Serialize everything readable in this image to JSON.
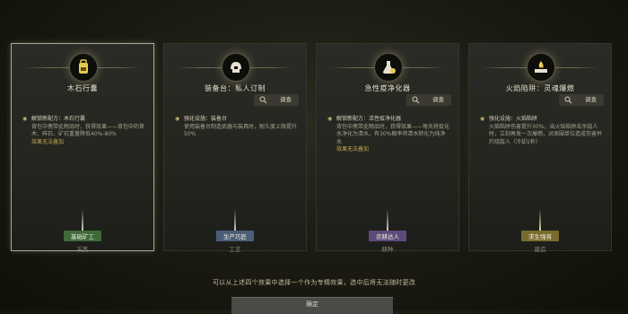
{
  "cards": [
    {
      "title": "木石行囊",
      "tag_button": "",
      "bullet_head": "解锁新配方：木石行囊",
      "bullet_body": "背包中携带此物品时，获得效果——背包中的草木、碎石、矿石重量降低40%-80%",
      "note": "效果无法叠加",
      "badge": "基础矿工",
      "category": "采集",
      "badge_color": "#3f6a3a",
      "beam_color": "#cfe6c8"
    },
    {
      "title": "装备台：私人订制",
      "tag_button": "调查",
      "bullet_head": "强化设施：装备台",
      "bullet_body": "使用装备台制造武器与装具时，耐久度上限提升50%",
      "note": "",
      "badge": "生产巧匠",
      "category": "工艺",
      "badge_color": "#4a5e77",
      "beam_color": "#cfd8e6"
    },
    {
      "title": "急性疫净化器",
      "tag_button": "调查",
      "bullet_head": "解锁新配方：活性疫净化器",
      "bullet_body": "背包中携带此物品时，获得效果——每天将疫化水净化为清水，有30%概率将清水转化为纯净水",
      "note": "效果无法叠加",
      "badge": "农耕达人",
      "category": "耕种",
      "badge_color": "#5d4a7a",
      "beam_color": "#e0d0f2"
    },
    {
      "title": "火焰陷阱：灵魂爆燃",
      "tag_button": "调查",
      "bullet_head": "强化设施：火焰陷阱",
      "bullet_body": "火焰陷阱伤害提升30%，当火焰陷阱击杀敌人时，立刻再发一次爆燃，对周围单位造成伤害并灼烧敌人（冷却1秒）",
      "note": "",
      "badge": "求生强将",
      "category": "建造",
      "badge_color": "#7a6a2e",
      "beam_color": "#f2e8b8"
    }
  ],
  "footer_text": "可以从上述四个效果中选择一个作为专精效果，选中后将无法随时更改",
  "confirm_label": "确定",
  "icons": [
    "backpack-icon",
    "helmet-icon",
    "flask-icon",
    "flame-trap-icon",
    "magnifier-icon",
    "bullet-icon"
  ]
}
